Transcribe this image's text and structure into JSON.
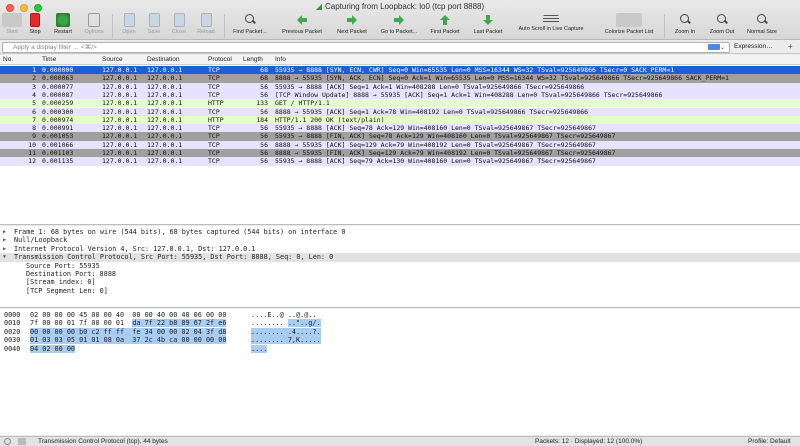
{
  "window": {
    "title": "Capturing from Loopback: lo0 (tcp port 8888)"
  },
  "toolbar": {
    "start": "Start",
    "stop": "Stop",
    "restart": "Restart",
    "options": "Options",
    "open": "Open",
    "save": "Save",
    "close": "Close",
    "reload": "Reload",
    "find": "Find Packet...",
    "prev": "Previous Packet",
    "next": "Next Packet",
    "goto": "Go to Packet...",
    "first": "First Packet",
    "last": "Last Packet",
    "autoscroll": "Auto Scroll in Live Capture",
    "colorize": "Colorize Packet List",
    "zoom_in": "Zoom In",
    "zoom_out": "Zoom Out",
    "normal": "Normal Size"
  },
  "filter": {
    "placeholder": "Apply a display filter … <⌘/>",
    "expression": "Expression…",
    "plus": "+"
  },
  "columns": {
    "no": "No.",
    "time": "Time",
    "source": "Source",
    "destination": "Destination",
    "protocol": "Protocol",
    "length": "Length",
    "info": "Info"
  },
  "colors": {
    "selected": "#1e5fd6",
    "tcp": "#e6e2ff",
    "http": "#e4ffc7",
    "fin": "#a0a0a0",
    "highlight": "#a9cdf1"
  },
  "packets": [
    {
      "no": "1",
      "time": "0.000000",
      "src": "127.0.0.1",
      "dst": "127.0.0.1",
      "proto": "TCP",
      "len": "68",
      "info": "55935 → 8888 [SYN, ECN, CWR] Seq=0 Win=65535 Len=0 MSS=16344 WS=32 TSval=925649866 TSecr=0 SACK_PERM=1",
      "kind": "selected"
    },
    {
      "no": "2",
      "time": "0.000063",
      "src": "127.0.0.1",
      "dst": "127.0.0.1",
      "proto": "TCP",
      "len": "68",
      "info": "8888 → 55935 [SYN, ACK, ECN] Seq=0 Ack=1 Win=65535 Len=0 MSS=16344 WS=32 TSval=925649866 TSecr=925649866 SACK_PERM=1",
      "kind": "fin"
    },
    {
      "no": "3",
      "time": "0.000077",
      "src": "127.0.0.1",
      "dst": "127.0.0.1",
      "proto": "TCP",
      "len": "56",
      "info": "55935 → 8888 [ACK] Seq=1 Ack=1 Win=408288 Len=0 TSval=925649866 TSecr=925649866",
      "kind": "tcp"
    },
    {
      "no": "4",
      "time": "0.000087",
      "src": "127.0.0.1",
      "dst": "127.0.0.1",
      "proto": "TCP",
      "len": "56",
      "info": "[TCP Window Update] 8888 → 55935 [ACK] Seq=1 Ack=1 Win=408288 Len=0 TSval=925649866 TSecr=925649866",
      "kind": "tcp"
    },
    {
      "no": "5",
      "time": "0.000259",
      "src": "127.0.0.1",
      "dst": "127.0.0.1",
      "proto": "HTTP",
      "len": "133",
      "info": "GET / HTTP/1.1",
      "kind": "http"
    },
    {
      "no": "6",
      "time": "0.000300",
      "src": "127.0.0.1",
      "dst": "127.0.0.1",
      "proto": "TCP",
      "len": "56",
      "info": "8888 → 55935 [ACK] Seq=1 Ack=78 Win=408192 Len=0 TSval=925649866 TSecr=925649866",
      "kind": "tcp"
    },
    {
      "no": "7",
      "time": "0.000974",
      "src": "127.0.0.1",
      "dst": "127.0.0.1",
      "proto": "HTTP",
      "len": "184",
      "info": "HTTP/1.1 200 OK  (text/plain)",
      "kind": "http"
    },
    {
      "no": "8",
      "time": "0.000991",
      "src": "127.0.0.1",
      "dst": "127.0.0.1",
      "proto": "TCP",
      "len": "56",
      "info": "55935 → 8888 [ACK] Seq=78 Ack=129 Win=408160 Len=0 TSval=925649867 TSecr=925649867",
      "kind": "tcp"
    },
    {
      "no": "9",
      "time": "0.001053",
      "src": "127.0.0.1",
      "dst": "127.0.0.1",
      "proto": "TCP",
      "len": "56",
      "info": "55935 → 8888 [FIN, ACK] Seq=78 Ack=129 Win=408160 Len=0 TSval=925649867 TSecr=925649867",
      "kind": "fin"
    },
    {
      "no": "10",
      "time": "0.001066",
      "src": "127.0.0.1",
      "dst": "127.0.0.1",
      "proto": "TCP",
      "len": "56",
      "info": "8888 → 55935 [ACK] Seq=129 Ack=79 Win=408192 Len=0 TSval=925649867 TSecr=925649867",
      "kind": "tcp"
    },
    {
      "no": "11",
      "time": "0.001103",
      "src": "127.0.0.1",
      "dst": "127.0.0.1",
      "proto": "TCP",
      "len": "56",
      "info": "8888 → 55935 [FIN, ACK] Seq=129 Ack=79 Win=408192 Len=0 TSval=925649867 TSecr=925649867",
      "kind": "fin"
    },
    {
      "no": "12",
      "time": "0.001135",
      "src": "127.0.0.1",
      "dst": "127.0.0.1",
      "proto": "TCP",
      "len": "56",
      "info": "55935 → 8888 [ACK] Seq=79 Ack=130 Win=408160 Len=0 TSval=925649867 TSecr=925649867",
      "kind": "tcp"
    }
  ],
  "details": [
    {
      "text": "Frame 1: 68 bytes on wire (544 bits), 68 bytes captured (544 bits) on interface 0",
      "indent": 0,
      "tri": "▶"
    },
    {
      "text": "Null/Loopback",
      "indent": 0,
      "tri": "▶"
    },
    {
      "text": "Internet Protocol Version 4, Src: 127.0.0.1, Dst: 127.0.0.1",
      "indent": 0,
      "tri": "▶"
    },
    {
      "text": "Transmission Control Protocol, Src Port: 55935, Dst Port: 8888, Seq: 0, Len: 0",
      "indent": 0,
      "tri": "▼",
      "sel": true
    },
    {
      "text": "Source Port: 55935",
      "indent": 1,
      "tri": ""
    },
    {
      "text": "Destination Port: 8888",
      "indent": 1,
      "tri": ""
    },
    {
      "text": "[Stream index: 0]",
      "indent": 1,
      "tri": ""
    },
    {
      "text": "[TCP Segment Len: 0]",
      "indent": 1,
      "tri": ""
    }
  ],
  "bytes": [
    {
      "offset": "0000",
      "hex_plain": "02 00 00 00 45 00 00 40  00 00 40 00 40 06 00 00",
      "hex_hl": "",
      "ascii_plain": "....E..@ ..@.@..",
      "ascii_hl": ""
    },
    {
      "offset": "0010",
      "hex_plain": "7f 00 00 01 7f 00 00 01  ",
      "hex_hl": "da 7f 22 b8 89 67 2f e6",
      "ascii_plain": "........ ",
      "ascii_hl": "..\"..g/."
    },
    {
      "offset": "0020",
      "hex_plain": "",
      "hex_hl": "00 00 00 00 b0 c2 ff ff  fe 34 00 00 02 04 3f d8",
      "ascii_plain": "",
      "ascii_hl": "........ .4....?."
    },
    {
      "offset": "0030",
      "hex_plain": "",
      "hex_hl": "01 03 03 05 01 01 08 0a  37 2c 4b ca 00 00 00 00",
      "ascii_plain": "",
      "ascii_hl": "........ 7,K....."
    },
    {
      "offset": "0040",
      "hex_plain": "",
      "hex_hl": "04 02 00 00",
      "ascii_plain": "",
      "ascii_hl": "...."
    }
  ],
  "status": {
    "text": "Transmission Control Protocol (tcp), 44 bytes",
    "packets": "Packets: 12 · Displayed: 12 (100.0%)",
    "profile": "Profile: Default"
  }
}
